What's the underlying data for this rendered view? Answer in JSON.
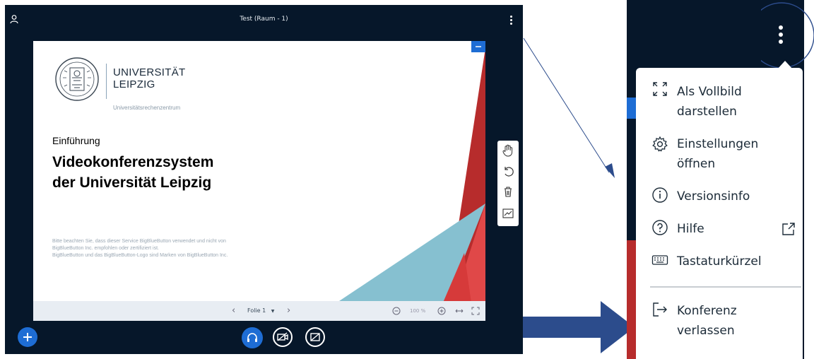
{
  "app": {
    "room_title": "Test (Raum - 1)"
  },
  "slide": {
    "university_line1": "UNIVERSITÄT",
    "university_line2": "LEIPZIG",
    "university_sub": "Universitätsrechenzentrum",
    "intro": "Einführung",
    "title_line1": "Videokonferenzsystem",
    "title_line2": "der Universität Leipzig",
    "disclaimer_line1": "Bitte beachten Sie, dass dieser Service BigBlueButton verwendet und nicht von",
    "disclaimer_line2": "BigBlueButton Inc. empfohlen oder zertifiziert ist.",
    "disclaimer_line3": "BigBlueButton und das BigBlueButton-Logo sind Marken von BigBlueButton Inc."
  },
  "footer": {
    "slide_select": "Folie 1",
    "zoom_level": "100 %"
  },
  "menu": {
    "items": [
      {
        "line1": "Als Vollbild",
        "line2": "darstellen",
        "icon": "fullscreen-icon"
      },
      {
        "line1": "Einstellungen",
        "line2": "öffnen",
        "icon": "gear-icon"
      },
      {
        "line1": "Versionsinfo",
        "icon": "info-icon"
      },
      {
        "line1": "Hilfe",
        "icon": "help-icon"
      },
      {
        "line1": "Tastaturkürzel",
        "icon": "keyboard-icon"
      },
      {
        "line1": "Konferenz",
        "line2": "verlassen",
        "icon": "logout-icon"
      }
    ]
  },
  "colors": {
    "dark_bg": "#06172a",
    "accent_blue": "#1e6dd4",
    "slide_red": "#c62c2c",
    "slide_teal": "#84bfcf",
    "annotation_arrow": "#2c4c8c"
  }
}
